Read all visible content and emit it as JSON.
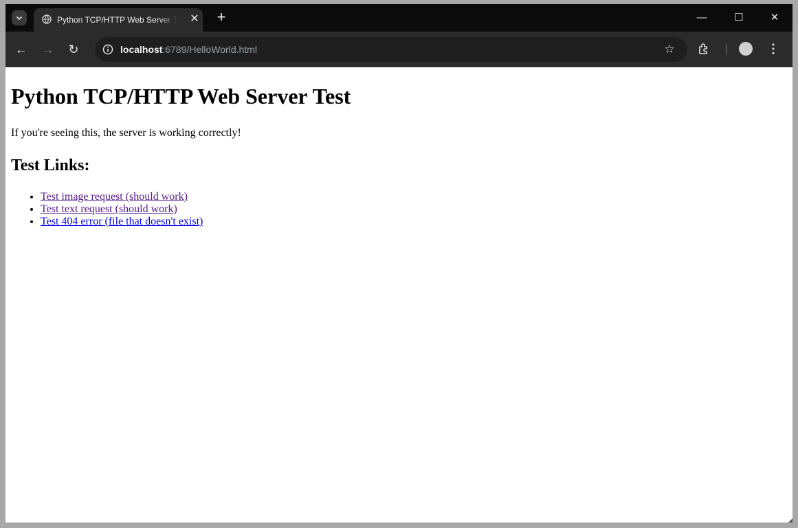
{
  "browser": {
    "tab": {
      "title": "Python TCP/HTTP Web Server Test",
      "close_glyph": "✕",
      "favicon": "globe-icon"
    },
    "new_tab_glyph": "+",
    "window_controls": {
      "minimize": "—",
      "maximize": "☐",
      "close": "✕"
    },
    "nav": {
      "back": "←",
      "forward": "→",
      "reload": "↻"
    },
    "address": {
      "host": "localhost",
      "rest": ":6789/HelloWorld.html"
    },
    "bookmark_glyph": "☆",
    "menu_glyph": "⋮"
  },
  "page": {
    "title": "Python TCP/HTTP Web Server Test",
    "intro": "If you're seeing this, the server is working correctly!",
    "links_heading": "Test Links:",
    "links": [
      {
        "text": "Test image request (should work)",
        "visited": true
      },
      {
        "text": "Test text request (should work)",
        "visited": true
      },
      {
        "text": "Test 404 error (file that doesn't exist)",
        "visited": false
      }
    ]
  },
  "colors": {
    "visited_link": "#551a8b",
    "unvisited_link": "#0000ee",
    "titlebar": "#0b0b0b",
    "toolbar": "#2b2b2b"
  }
}
